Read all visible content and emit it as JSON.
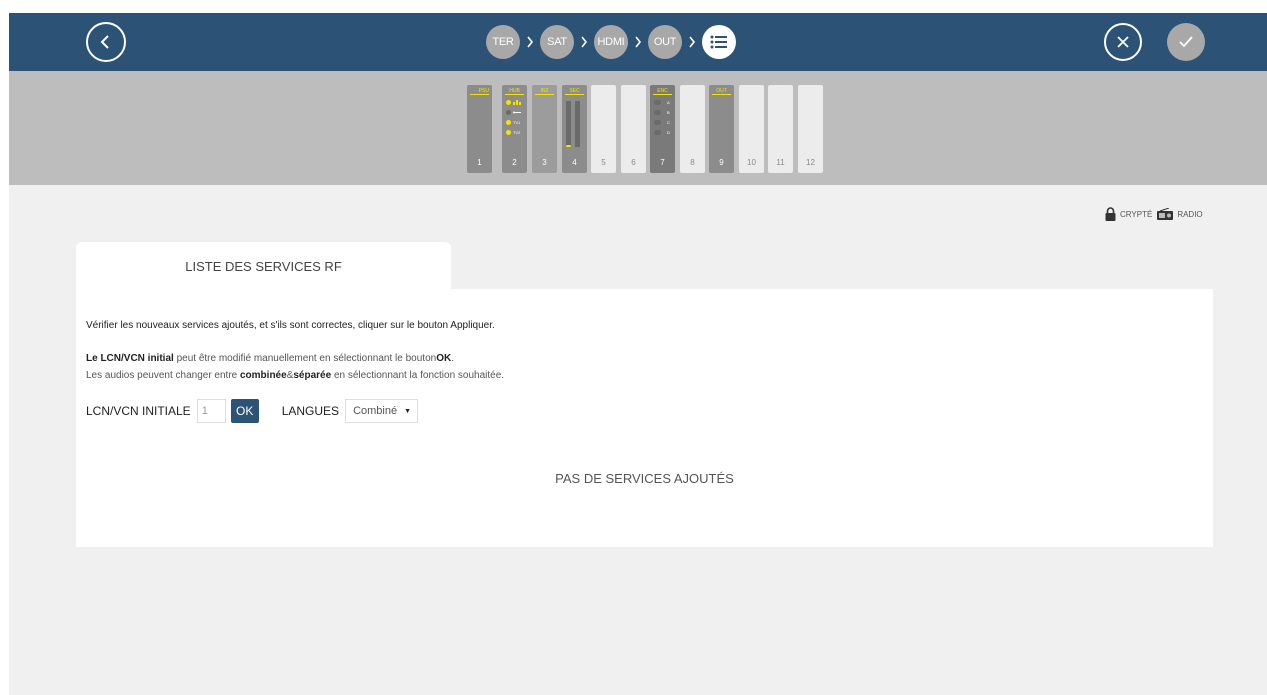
{
  "steps": [
    {
      "label": "TER",
      "active": false
    },
    {
      "label": "SAT",
      "active": false
    },
    {
      "label": "HDMI",
      "active": false
    },
    {
      "label": "OUT",
      "active": false
    }
  ],
  "rack": {
    "slots": [
      {
        "num": "1",
        "name": "PSU",
        "filled": true
      },
      {
        "num": "2",
        "name": "HUB",
        "filled": true,
        "ports": [
          "",
          "",
          "TV1",
          "TV2"
        ]
      },
      {
        "num": "3",
        "name": "IN2",
        "filled": true
      },
      {
        "num": "4",
        "name": "SEC",
        "filled": true
      },
      {
        "num": "5",
        "name": "",
        "filled": false
      },
      {
        "num": "6",
        "name": "",
        "filled": false
      },
      {
        "num": "7",
        "name": "ENC",
        "filled": true,
        "ports": [
          "A",
          "B",
          "C",
          "D"
        ]
      },
      {
        "num": "8",
        "name": "",
        "filled": false
      },
      {
        "num": "9",
        "name": "OUT",
        "filled": true
      },
      {
        "num": "10",
        "name": "",
        "filled": false
      },
      {
        "num": "11",
        "name": "",
        "filled": false
      },
      {
        "num": "12",
        "name": "",
        "filled": false
      }
    ]
  },
  "legend": {
    "encrypted": "CRYPTÉ",
    "radio": "RADIO"
  },
  "tab": {
    "label": "LISTE DES SERVICES RF"
  },
  "content": {
    "instruction": "Vérifier les nouveaux services ajoutés, et s'ils sont correctes, cliquer sur le bouton Appliquer.",
    "lcn_bold": "Le LCN/VCN initial",
    "lcn_text": " peut être modifié manuellement en sélectionnant le bouton",
    "lcn_ok": "OK",
    "lcn_end": ".",
    "audio_text1": "Les audios peuvent changer entre ",
    "audio_combined": "combinée",
    "audio_amp": "&",
    "audio_separate": "séparée",
    "audio_text2": " en sélectionnant la fonction souhaitée.",
    "lcn_label": "LCN/VCN INITIALE",
    "lcn_value": "1",
    "ok_label": "OK",
    "langues_label": "LANGUES",
    "langues_value": "Combiné",
    "empty_message": "PAS DE SERVICES AJOUTÉS"
  },
  "colors": {
    "topbar": "#2c5276",
    "rack_band": "#bdbdbd",
    "accent_yellow": "#f4e400"
  },
  "icons": {
    "back": "chevron-left-icon",
    "steps_current": "list-icon",
    "cancel": "close-icon",
    "apply": "check-icon",
    "encrypted": "lock-icon",
    "radio": "radio-icon"
  }
}
